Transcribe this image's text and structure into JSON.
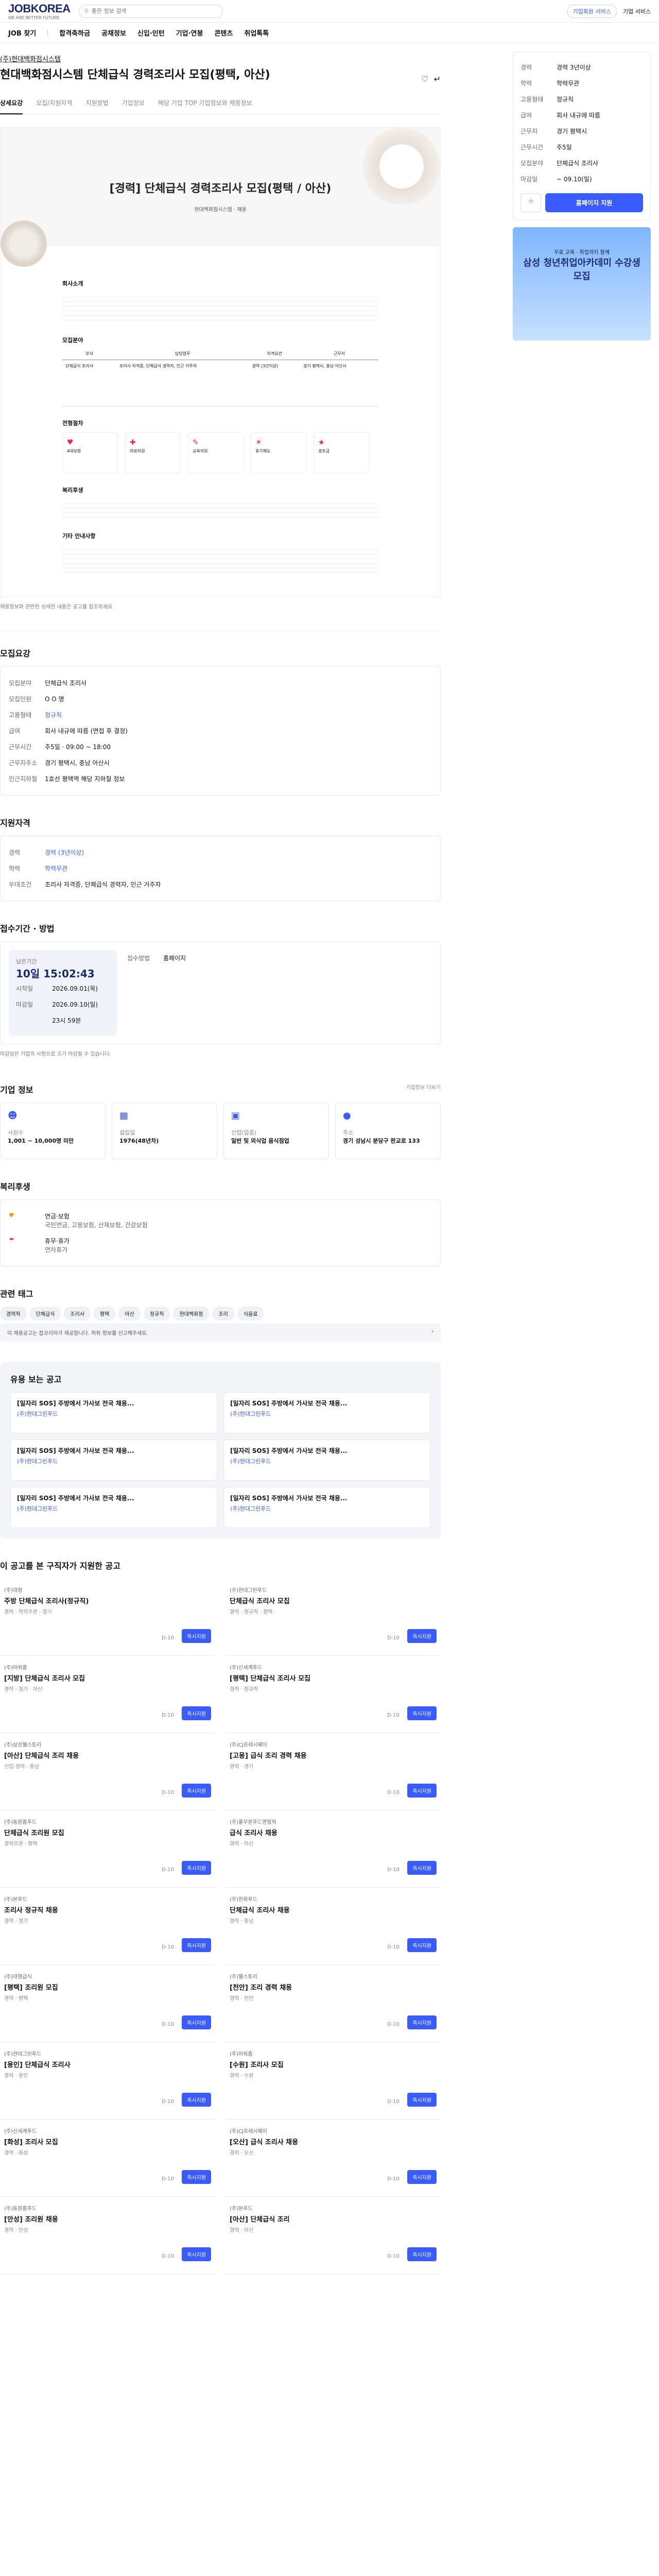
{
  "header": {
    "logo": "JOBKOREA",
    "logo_sub": "WE ARE BETTER FUTURE",
    "search_placeholder": "좋은 정보 검색",
    "links": [
      "기업회원 서비스",
      "기업 서비스"
    ]
  },
  "gnb": [
    "JOB 찾기",
    "합격축하금",
    "공채정보",
    "신입·인턴",
    "기업·연봉",
    "콘텐츠",
    "취업톡톡"
  ],
  "job": {
    "company": "(주)현대백화점시스템",
    "title": "현대백화점시스템 단체급식 경력조리사 모집(평택, 아산)",
    "tabs": [
      "상세요강",
      "모집/지원자격",
      "지원방법",
      "기업정보",
      "해당 기업 TOP 기업정보와 채용정보"
    ],
    "poster_title": "[경력] 단체급식 경력조리사 모집(평택 / 아산)",
    "poster_company": "현대백화점시스템 · 채용",
    "poster_sections": [
      "회사소개",
      "모집분야",
      "전형절차",
      "복리후생",
      "기타 안내사항"
    ],
    "table_head": [
      "부서",
      "담당업무",
      "자격요건",
      "근무지"
    ],
    "benefits": [
      "4대보험",
      "의료지원",
      "교육지원",
      "휴가제도",
      "경조금"
    ],
    "note": "채용정보와 관련된 상세한 내용은 공고를 참조하세요"
  },
  "recruit": {
    "title": "모집요강",
    "rows": [
      [
        "모집분야",
        "단체급식 조리사"
      ],
      [
        "모집인원",
        "O O 명"
      ],
      [
        "고용형태",
        "정규직"
      ],
      [
        "급여",
        "회사 내규에 따름 (면접 후 결정)"
      ],
      [
        "근무시간",
        "주5일 · 09:00 ~ 18:00"
      ],
      [
        "근무지주소",
        "경기 평택시, 충남 아산시"
      ],
      [
        "인근지하철",
        "1호선 평택역 해당 지하철 정보"
      ]
    ]
  },
  "qual": {
    "title": "지원자격",
    "rows": [
      [
        "경력",
        "경력 (3년이상)"
      ],
      [
        "학력",
        "학력무관"
      ],
      [
        "우대조건",
        "조리사 자격증, 단체급식 경력자, 인근 거주자"
      ]
    ]
  },
  "deadline": {
    "title": "접수기간 · 방법",
    "label": "남은기간",
    "remain": "10일 15:02:43",
    "start_k": "시작일",
    "start": "2026.09.01(목)",
    "end_k": "마감일",
    "end": "2026.09.10(일)",
    "time": "23시 59분",
    "method_k": "접수방법",
    "method": "홈페이지",
    "note": "마감일은 기업의 사정으로 조기 마감될 수 있습니다."
  },
  "company_info": {
    "title": "기업 정보",
    "link": "기업정보 더보기",
    "cards": [
      [
        "사원수",
        "1,001 ~ 10,000명 미만"
      ],
      [
        "설립일",
        "1976(48년차)"
      ],
      [
        "산업(업종)",
        "일반 및 외식업 음식점업"
      ],
      [
        "주소",
        "경기 성남시 분당구 판교로 133"
      ]
    ]
  },
  "welfare": {
    "title": "복리후생",
    "items": [
      [
        "연금·보험",
        "국민연금, 고용보험, 산재보험, 건강보험"
      ],
      [
        "휴무·휴가",
        "연차휴가"
      ]
    ]
  },
  "tags": {
    "title": "관련 태그",
    "items": [
      "경력직",
      "단체급식",
      "조리사",
      "평택",
      "아산",
      "정규직",
      "현대백화점",
      "조리",
      "식음료"
    ]
  },
  "strip": "이 채용공고는 잡코리아가 제공합니다. 허위 정보를 신고해주세요.",
  "recommend": {
    "title": "유용 보는 공고",
    "items": [
      [
        "[일자리 SOS] 주방에서 가사보 전국 채용...",
        "(주)현대그린푸드"
      ],
      [
        "[일자리 SOS] 주방에서 가사보 전국 채용...",
        "(주)현대그린푸드"
      ],
      [
        "[일자리 SOS] 주방에서 가사보 전국 채용...",
        "(주)현대그린푸드"
      ],
      [
        "[일자리 SOS] 주방에서 가사보 전국 채용...",
        "(주)현대그린푸드"
      ],
      [
        "[일자리 SOS] 주방에서 가사보 전국 채용...",
        "(주)현대그린푸드"
      ],
      [
        "[일자리 SOS] 주방에서 가사보 전국 채용...",
        "(주)현대그린푸드"
      ]
    ]
  },
  "list": {
    "title": "이 공고를 본 구직자가 지원한 공고",
    "items": [
      [
        "(주)대형",
        "주방 단체급식 조리사(정규직)",
        "경력 · 학력무관 · 경기"
      ],
      [
        "(주)현대그린푸드",
        "단체급식 조리사 모집",
        "경력 · 정규직 · 평택"
      ],
      [
        "(주)아워홈",
        "[지방] 단체급식 조리사 모집",
        "경력 · 경기 · 아산"
      ],
      [
        "(주)신세계푸드",
        "[평택] 단체급식 조리사 모집",
        "경력 · 정규직"
      ],
      [
        "(주)삼성웰스토리",
        "[아산] 단체급식 조리 채용",
        "신입·경력 · 충남"
      ],
      [
        "(주)CJ프레시웨이",
        "[고용] 급식 조리 경력 채용",
        "경력 · 경기"
      ],
      [
        "(주)동원홈푸드",
        "단체급식 조리원 모집",
        "경력무관 · 평택"
      ],
      [
        "(주)풀무원푸드앤컬처",
        "급식 조리사 채용",
        "경력 · 아산"
      ],
      [
        "(주)본푸드",
        "조리사 정규직 채용",
        "경력 · 경기"
      ],
      [
        "(주)한화푸드",
        "단체급식 조리사 채용",
        "경력 · 충남"
      ],
      [
        "(주)대형급식",
        "[평택] 조리원 모집",
        "경력 · 평택"
      ],
      [
        "(주)웰스토리",
        "[천안] 조리 경력 채용",
        "경력 · 천안"
      ],
      [
        "(주)현대그린푸드",
        "[용인] 단체급식 조리사",
        "경력 · 용인"
      ],
      [
        "(주)아워홈",
        "[수원] 조리사 모집",
        "경력 · 수원"
      ],
      [
        "(주)신세계푸드",
        "[화성] 조리사 모집",
        "경력 · 화성"
      ],
      [
        "(주)CJ프레시웨이",
        "[오산] 급식 조리사 채용",
        "경력 · 오산"
      ],
      [
        "(주)동원홈푸드",
        "[안성] 조리원 채용",
        "경력 · 안성"
      ],
      [
        "(주)본푸드",
        "[아산] 단체급식 조리",
        "경력 · 아산"
      ]
    ],
    "btn": "즉시지원",
    "dday": "D-10"
  },
  "side": {
    "rows": [
      [
        "경력",
        "경력 3년이상"
      ],
      [
        "학력",
        "학력무관"
      ],
      [
        "고용형태",
        "정규직"
      ],
      [
        "급여",
        "회사 내규에 따름"
      ],
      [
        "근무지",
        "경기 평택시"
      ],
      [
        "근무시간",
        "주5일"
      ],
      [
        "모집분야",
        "단체급식 조리사"
      ],
      [
        "마감일",
        "~ 09.10(일)"
      ]
    ],
    "apply": "홈페이지 지원",
    "ad_title": "삼성 청년취업아카데미 수강생 모집",
    "ad_sub": "무료 교육 · 취업까지 함께"
  }
}
